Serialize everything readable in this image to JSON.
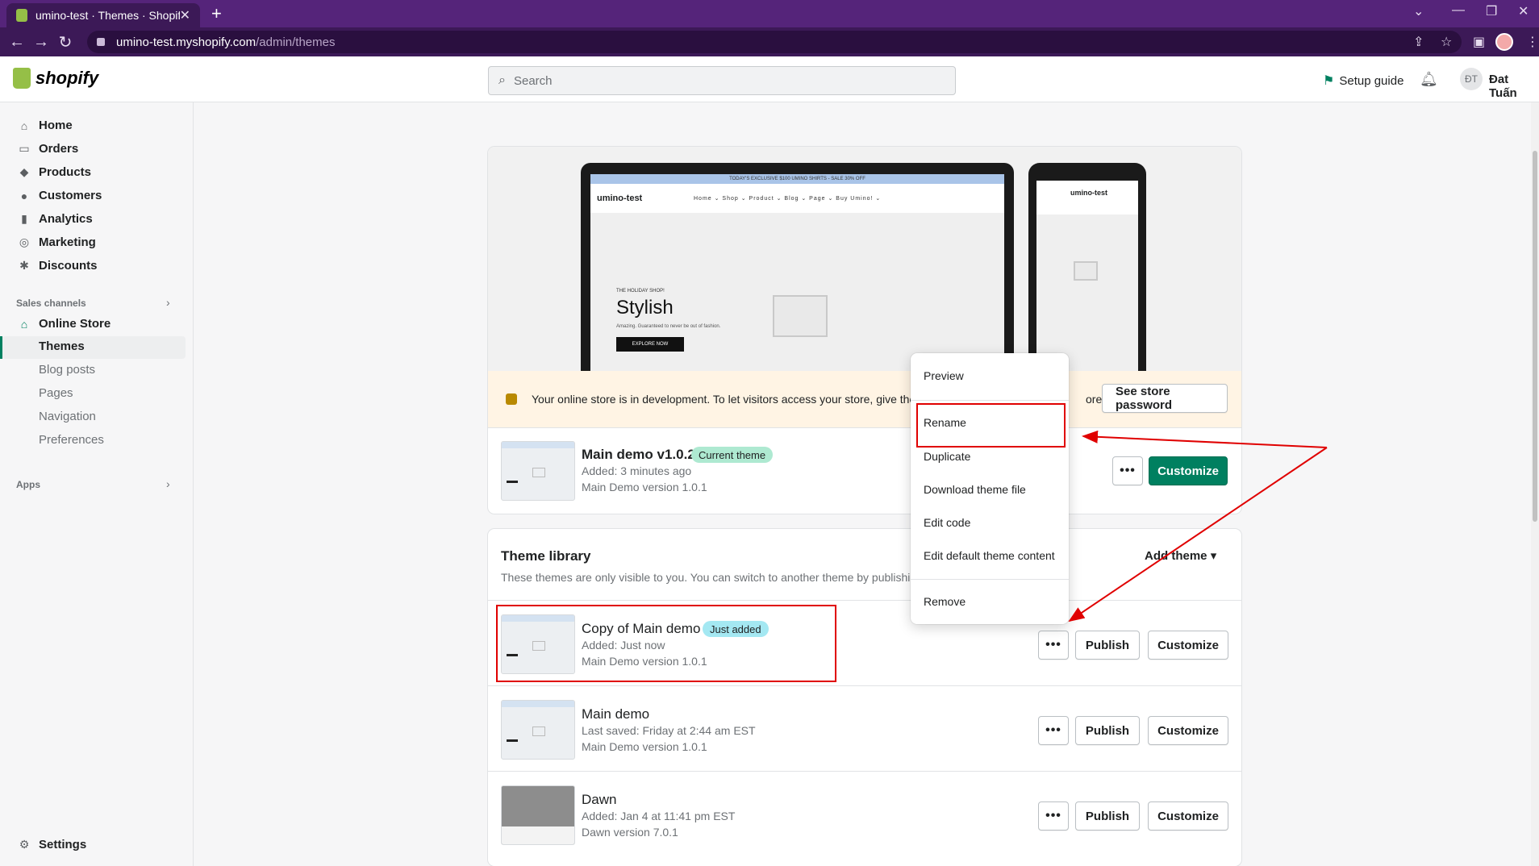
{
  "browser": {
    "tab_title": "umino-test · Themes · Shopify",
    "new_tab": "+",
    "url_host": "umino-test.myshopify.com",
    "url_path": "/admin/themes"
  },
  "topbar": {
    "logo": "shopify",
    "search_placeholder": "Search",
    "setup_guide": "Setup guide",
    "avatar_initials": "ĐT",
    "user_name": "Đat Tuấn"
  },
  "sidebar": {
    "items": [
      {
        "label": "Home",
        "icon": "home-icon"
      },
      {
        "label": "Orders",
        "icon": "orders-icon"
      },
      {
        "label": "Products",
        "icon": "tag-icon"
      },
      {
        "label": "Customers",
        "icon": "person-icon"
      },
      {
        "label": "Analytics",
        "icon": "bar-chart-icon"
      },
      {
        "label": "Marketing",
        "icon": "target-icon"
      },
      {
        "label": "Discounts",
        "icon": "discount-icon"
      }
    ],
    "sales_channels_label": "Sales channels",
    "online_store": "Online Store",
    "online_store_sub": [
      "Themes",
      "Blog posts",
      "Pages",
      "Navigation",
      "Preferences"
    ],
    "apps_label": "Apps",
    "settings": "Settings"
  },
  "preview": {
    "promo": "TODAY'S EXCLUSIVE $100 UMINO SHIRTS - SALE 30% OFF",
    "store_name": "umino-test",
    "menu": "Home ⌄  Shop ⌄  Product ⌄  Blog ⌄  Page ⌄  Buy Umino! ⌄",
    "hero_eyebrow": "THE HOLIDAY SHOP!",
    "hero_title": "Stylish",
    "hero_sub": "Amazing. Guaranteed to never be out of fashion.",
    "hero_button": "EXPLORE NOW",
    "mobile_store_name": "umino-test"
  },
  "dev_banner": {
    "text": "Your online store is in development. To let visitors access your store, give the",
    "text_tail": "ore",
    "button": "See store password"
  },
  "current_theme": {
    "name": "Main demo v1.0.2",
    "badge": "Current theme",
    "added": "Added: 3 minutes ago",
    "version": "Main Demo version 1.0.1",
    "dots": "•••",
    "customize": "Customize"
  },
  "library": {
    "title": "Theme library",
    "description": "These themes are only visible to you. You can switch to another theme by publishin",
    "add_theme": "Add theme",
    "themes": [
      {
        "name": "Copy of Main demo",
        "badge": "Just added",
        "meta": "Added: Just now",
        "version": "Main Demo version 1.0.1"
      },
      {
        "name": "Main demo",
        "badge": "",
        "meta": "Last saved: Friday at 2:44 am EST",
        "version": "Main Demo version 1.0.1"
      },
      {
        "name": "Dawn",
        "badge": "",
        "meta": "Added: Jan 4 at 11:41 pm EST",
        "version": "Dawn version 7.0.1"
      }
    ],
    "dots": "•••",
    "publish": "Publish",
    "customize": "Customize"
  },
  "popover_menu": {
    "items": [
      "Preview",
      "Rename",
      "Duplicate",
      "Download theme file",
      "Edit code",
      "Edit default theme content",
      "Remove"
    ]
  },
  "colors": {
    "browser_purple": "#55247a",
    "shopify_green": "#008060",
    "annotation_red": "#e00000"
  }
}
